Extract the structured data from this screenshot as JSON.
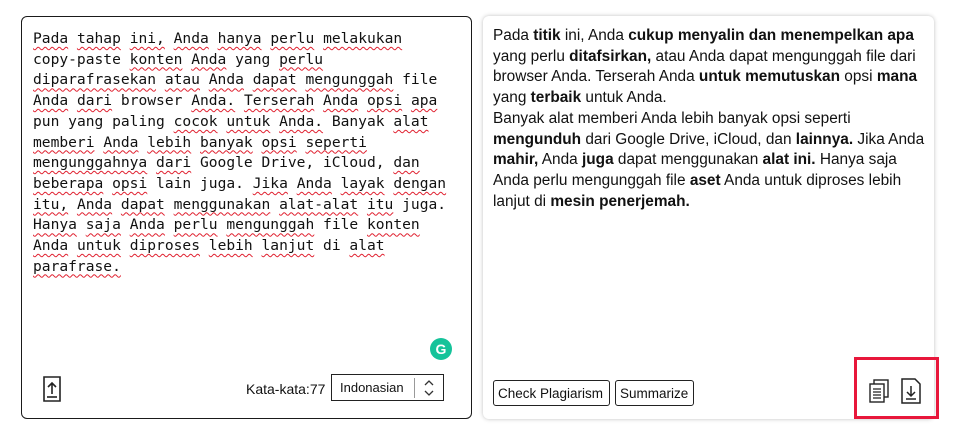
{
  "input": {
    "text": "Pada tahap ini, Anda hanya perlu melakukan copy-paste konten Anda yang perlu diparafrasekan atau Anda dapat mengunggah file Anda dari browser Anda. Terserah Anda opsi apa pun yang paling cocok untuk Anda. Banyak alat memberi Anda lebih banyak opsi seperti mengunggahnya dari Google Drive, iCloud, dan beberapa opsi lain juga. Jika Anda layak dengan itu, Anda dapat menggunakan alat-alat itu juga. Hanya saja Anda perlu mengunggah file konten Anda untuk diproses lebih lanjut di alat parafrase."
  },
  "footer": {
    "word_count_label": "Kata-kata:",
    "word_count_value": "77",
    "language": "Indonasian"
  },
  "output": {
    "text": "Pada titik ini, Anda cukup menyalin dan menempelkan apa yang perlu ditafsirkan, atau Anda dapat mengunggah file  dari browser Anda. Terserah Anda untuk memutuskan opsi mana yang terbaik untuk Anda. Banyak alat memberi Anda lebih banyak opsi seperti mengunduh dari Google Drive, iCloud, dan lainnya. Jika Anda mahir, Anda juga dapat menggunakan alat ini. Hanya saja Anda perlu mengunggah file aset Anda untuk diproses lebih lanjut di mesin penerjemah.",
    "segments": [
      {
        "t": "Pada ",
        "b": false
      },
      {
        "t": "titik",
        "b": true
      },
      {
        "t": " ini, Anda ",
        "b": false
      },
      {
        "t": "cukup menyalin dan menempelkan apa",
        "b": true
      },
      {
        "t": " yang perlu ",
        "b": false
      },
      {
        "t": "ditafsirkan,",
        "b": true
      },
      {
        "t": " atau Anda dapat mengunggah file  dari browser Anda. Terserah Anda ",
        "b": false
      },
      {
        "t": "untuk memutuskan",
        "b": true
      },
      {
        "t": " opsi ",
        "b": false
      },
      {
        "t": "mana",
        "b": true
      },
      {
        "t": " yang ",
        "b": false
      },
      {
        "t": "terbaik",
        "b": true
      },
      {
        "t": " untuk Anda.",
        "b": false
      },
      {
        "t": "BR",
        "b": false
      },
      {
        "t": "Banyak alat memberi Anda lebih banyak opsi seperti ",
        "b": false
      },
      {
        "t": "mengunduh",
        "b": true
      },
      {
        "t": " dari Google Drive, iCloud, dan ",
        "b": false
      },
      {
        "t": "lainnya.",
        "b": true
      },
      {
        "t": " Jika Anda ",
        "b": false
      },
      {
        "t": "mahir,",
        "b": true
      },
      {
        "t": " Anda ",
        "b": false
      },
      {
        "t": "juga",
        "b": true
      },
      {
        "t": " dapat menggunakan ",
        "b": false
      },
      {
        "t": "alat ini.",
        "b": true
      },
      {
        "t": " Hanya saja Anda perlu mengunggah file ",
        "b": false
      },
      {
        "t": "aset",
        "b": true
      },
      {
        "t": " Anda untuk diproses lebih lanjut di ",
        "b": false
      },
      {
        "t": "mesin penerjemah.",
        "b": true
      }
    ]
  },
  "buttons": {
    "check_plagiarism": "Check Plagiarism",
    "summarize": "Summarize"
  },
  "icons": {
    "grammarly": "G",
    "upload": "upload-icon",
    "copy": "copy-icon",
    "download": "download-icon",
    "select_arrows": "chevron-updown-icon"
  },
  "colors": {
    "grammarly": "#15c39a",
    "highlight": "#e8173b",
    "squiggle": "#e0202f"
  }
}
